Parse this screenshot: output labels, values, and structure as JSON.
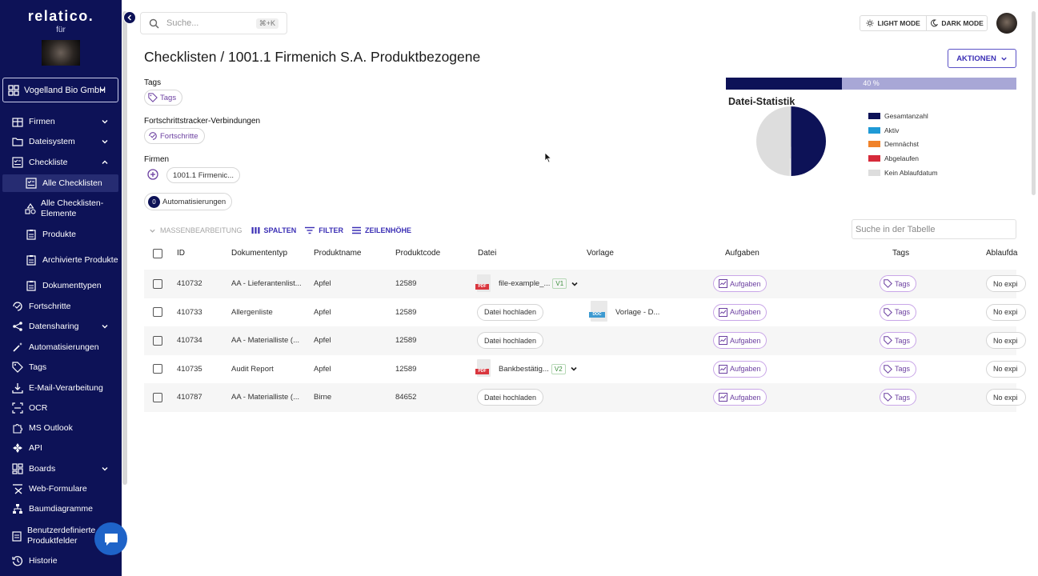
{
  "brand": {
    "name": "relatico.",
    "sub": "für"
  },
  "org": {
    "name": "Vogelland Bio GmbH"
  },
  "nav": [
    {
      "label": "Firmen"
    },
    {
      "label": "Dateisystem"
    },
    {
      "label": "Checkliste"
    },
    {
      "label": "Alle Checklisten"
    },
    {
      "label": "Alle Checklisten-Elemente"
    },
    {
      "label": "Produkte"
    },
    {
      "label": "Archivierte Produkte"
    },
    {
      "label": "Dokumenttypen"
    },
    {
      "label": "Fortschritte"
    },
    {
      "label": "Datensharing"
    },
    {
      "label": "Automatisierungen"
    },
    {
      "label": "Tags"
    },
    {
      "label": "E-Mail-Verarbeitung"
    },
    {
      "label": "OCR"
    },
    {
      "label": "MS Outlook"
    },
    {
      "label": "API"
    },
    {
      "label": "Boards"
    },
    {
      "label": "Web-Formulare"
    },
    {
      "label": "Baumdiagramme"
    },
    {
      "label": "Benutzerdefinierte Produktfelder"
    },
    {
      "label": "Historie"
    }
  ],
  "search": {
    "placeholder": "Suche...",
    "shortcut": "⌘+K"
  },
  "mode": {
    "light": "LIGHT MODE",
    "dark": "DARK MODE"
  },
  "page": {
    "title": "Checklisten / 1001.1 Firmenich S.A. Produktbezogene",
    "actions": "AKTIONEN"
  },
  "tags": {
    "label": "Tags",
    "chip": "Tags"
  },
  "tracker": {
    "label": "Fortschrittstracker-Verbindungen",
    "chip": "Fortschritte"
  },
  "firms": {
    "label": "Firmen",
    "chip": "1001.1 Firmenic..."
  },
  "automations": {
    "count": "0",
    "label": "Automatisierungen"
  },
  "stats": {
    "progress_label": "40 %",
    "progress": 0.4,
    "title": "Datei-Statistik",
    "legend": [
      {
        "label": "Gesamtanzahl",
        "color": "#0d1257"
      },
      {
        "label": "Aktiv",
        "color": "#1f9ad6"
      },
      {
        "label": "Demnächst",
        "color": "#f0822a"
      },
      {
        "label": "Abgelaufen",
        "color": "#d62a3a"
      },
      {
        "label": "Kein Ablaufdatum",
        "color": "#dddddd"
      }
    ],
    "pie_share_total": 0.5
  },
  "toolbar": {
    "bulk": "MASSENBEARBEITUNG",
    "columns": "SPALTEN",
    "filter": "FILTER",
    "row_height": "ZEILENHÖHE",
    "table_search": "Suche in der Tabelle"
  },
  "table": {
    "headers": [
      "ID",
      "Dokumententyp",
      "Produktname",
      "Produktcode",
      "Datei",
      "Vorlage",
      "Aufgaben",
      "Tags",
      "Ablaufda"
    ],
    "rows": [
      {
        "id": "410732",
        "type": "AA - Lieferantenlist...",
        "product": "Apfel",
        "code": "12589",
        "file": "file-example_...",
        "version": "V1",
        "template": "",
        "tasks": "Aufgaben",
        "tags": "Tags",
        "expiry": "No expi"
      },
      {
        "id": "410733",
        "type": "Allergenliste",
        "product": "Apfel",
        "code": "12589",
        "file": "",
        "upload": "Datei hochladen",
        "template": "Vorlage - D...",
        "tasks": "Aufgaben",
        "tags": "Tags",
        "expiry": "No expi"
      },
      {
        "id": "410734",
        "type": "AA - Materialliste (...",
        "product": "Apfel",
        "code": "12589",
        "file": "",
        "upload": "Datei hochladen",
        "template": "",
        "tasks": "Aufgaben",
        "tags": "Tags",
        "expiry": "No expi"
      },
      {
        "id": "410735",
        "type": "Audit Report",
        "product": "Apfel",
        "code": "12589",
        "file": "Bankbestätig...",
        "version": "V2",
        "template": "",
        "tasks": "Aufgaben",
        "tags": "Tags",
        "expiry": "No expi"
      },
      {
        "id": "410787",
        "type": "AA - Materialliste (...",
        "product": "Birne",
        "code": "84652",
        "file": "",
        "upload": "Datei hochladen",
        "template": "",
        "tasks": "Aufgaben",
        "tags": "Tags",
        "expiry": "No expi"
      }
    ]
  },
  "icons": {
    "file_pdf": "PDF",
    "file_doc": "DOC"
  }
}
